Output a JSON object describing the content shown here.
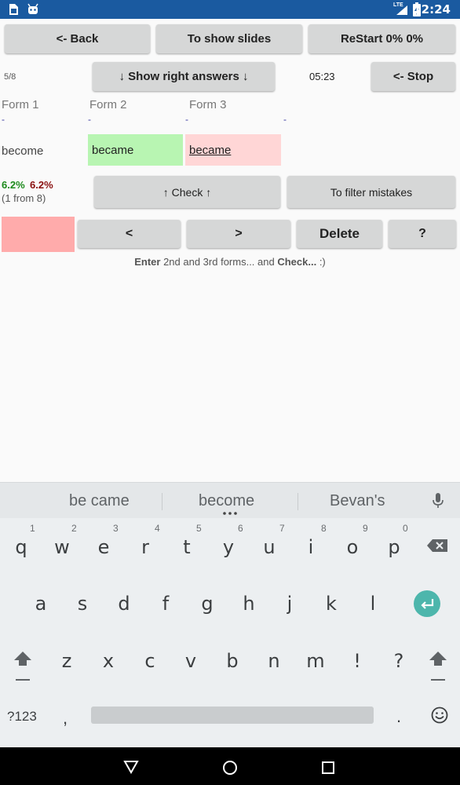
{
  "status_bar": {
    "time": "12:24",
    "lte": "LTE"
  },
  "toolbar": {
    "back_label": "<- Back",
    "show_slides_label": "To show slides",
    "restart_label": "ReStart 0% 0%"
  },
  "progress": {
    "position": "5/8",
    "show_answers_label": "↓ Show right answers ↓",
    "timer": "05:23",
    "stop_label": "<- Stop"
  },
  "forms": {
    "headers": [
      "Form 1",
      "Form 2",
      "Form 3"
    ],
    "placeholders": [
      "-",
      "-",
      "-",
      "-"
    ],
    "form1_value": "become",
    "form2_value": "became",
    "form3_value": "became",
    "form2_color": "#b8f5b2",
    "form3_color": "#ffd6d6"
  },
  "score": {
    "correct_pct": "6.2%",
    "wrong_pct": "6.2%",
    "count": "(1 from 8)",
    "correct_color": "#1c8a1c",
    "wrong_color": "#8a1010"
  },
  "actions": {
    "check_label": "↑ Check ↑",
    "filter_label": "To filter mistakes",
    "prev_label": "<",
    "next_label": ">",
    "delete_label": "Delete",
    "help_label": "?",
    "indicator_color": "#ffabab"
  },
  "instruction": {
    "bold1": "Enter",
    "text1": " 2nd and 3rd forms... and ",
    "bold2": "Check...",
    "text2": " :)"
  },
  "keyboard": {
    "suggestions": [
      "be came",
      "become",
      "Bevan's"
    ],
    "row1": [
      "q",
      "w",
      "e",
      "r",
      "t",
      "y",
      "u",
      "i",
      "o",
      "p"
    ],
    "row1_hints": [
      "1",
      "2",
      "3",
      "4",
      "5",
      "6",
      "7",
      "8",
      "9",
      "0"
    ],
    "row2": [
      "a",
      "s",
      "d",
      "f",
      "g",
      "h",
      "j",
      "k",
      "l"
    ],
    "row3": [
      "z",
      "x",
      "c",
      "v",
      "b",
      "n",
      "m",
      "!",
      "?"
    ],
    "symbols_label": "?123",
    "comma": ",",
    "period": ".",
    "enter_color": "#4db6ac"
  }
}
